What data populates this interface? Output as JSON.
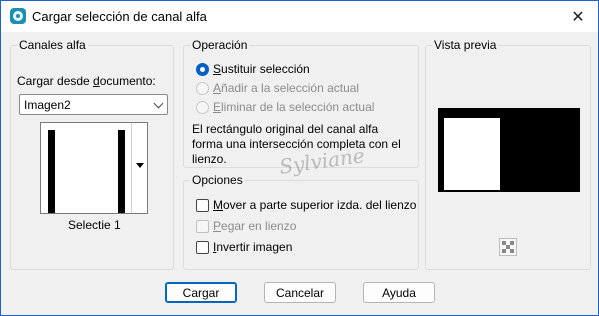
{
  "window": {
    "title": "Cargar selección de canal alfa",
    "close": "✕"
  },
  "canales": {
    "group_title": "Canales alfa",
    "load_from_label_pre": "Cargar desde ",
    "load_from_label_u": "d",
    "load_from_label_post": "ocumento:",
    "document_selected": "Imagen2",
    "channel_name": "Selectie 1"
  },
  "operacion": {
    "group_title": "Operación",
    "options": [
      {
        "u": "S",
        "rest": "ustituir selección",
        "checked": true,
        "disabled": false
      },
      {
        "u": "A",
        "rest": "ñadir a la selección actual",
        "checked": false,
        "disabled": true
      },
      {
        "u": "E",
        "rest": "liminar de la selección actual",
        "checked": false,
        "disabled": true
      }
    ],
    "info": "El rectángulo original del canal alfa forma una intersección completa con el lienzo."
  },
  "opciones": {
    "group_title": "Opciones",
    "items": [
      {
        "u": "M",
        "rest": "over a parte superior izda. del lienzo",
        "checked": false,
        "disabled": false
      },
      {
        "u": "P",
        "rest": "egar en lienzo",
        "checked": false,
        "disabled": true
      },
      {
        "u": "I",
        "rest": "nvertir imagen",
        "checked": false,
        "disabled": false
      }
    ]
  },
  "preview": {
    "group_title": "Vista previa",
    "checker_icon": "transparency-checker-icon"
  },
  "watermark": "Sylviane",
  "buttons": {
    "load": "Cargar",
    "cancel": "Cancelar",
    "help": "Ayuda"
  }
}
